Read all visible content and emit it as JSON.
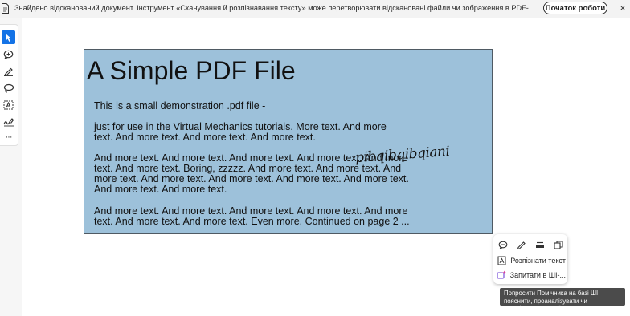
{
  "banner": {
    "text": "Знайдено відсканований документ. Інструмент «Сканування й розпізнавання тексту» може перетворювати відскановані файли чи зображення в PDF-документи з можлив...",
    "start_button": "Початок роботи",
    "close_glyph": "×"
  },
  "toolbar": {
    "tools": [
      "select-icon",
      "comment-icon",
      "pen-icon",
      "lasso-icon",
      "text-select-icon",
      "sign-icon",
      "more-icon"
    ],
    "more_glyph": "···"
  },
  "pdf": {
    "title": "A Simple PDF File",
    "lines": [
      "This is a small demonstration .pdf file -",
      "just for use in the Virtual Mechanics tutorials. More text. And more",
      "text. And more text. And more text. And more text.",
      "And more text. And more text. And more text. And more text. And more",
      "text. And more text. Boring, zzzzz. And more text. And more text. And",
      "more text. And more text. And more text. And more text. And more text.",
      "And more text. And more text.",
      "And more text. And more text. And more text. And more text. And more",
      "text. And more text. And more text. Even more. Continued on page 2 ..."
    ],
    "signature": "pibqibqibqiani"
  },
  "popup": {
    "icons": [
      "comment-icon",
      "pen-icon",
      "redact-icon",
      "copy-icon"
    ],
    "recognize_label": "Розпізнати текст",
    "ask_ai_label": "Запитати в ШІ-..."
  },
  "tooltip": {
    "text": "Попросити Помічника на базі ШІ пояснити, проаналізувати чи перефразувати цей текст"
  }
}
